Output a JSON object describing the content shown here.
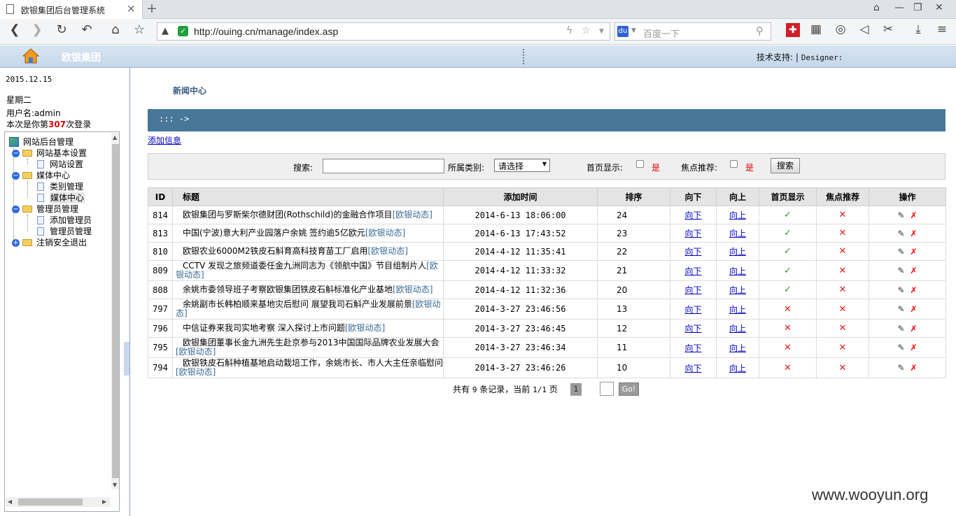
{
  "browser": {
    "tab_title": "欧银集团后台管理系统",
    "tab_close": "×",
    "new_tab": "+",
    "url": "http://ouing.cn/manage/index.asp",
    "search_placeholder": "百度一下"
  },
  "header": {
    "brand": "欧银集团",
    "support": "技术支持: | ",
    "designer": "Designer:"
  },
  "sidebar": {
    "date": "2015.12.15",
    "weekday": "星期二",
    "username": "用户名:admin",
    "login_prefix": "本次是你第",
    "login_count": "307",
    "login_suffix": "次登录",
    "tree": {
      "root": "网站后台管理",
      "basic": "网站基本设置",
      "site_settings": "网站设置",
      "media": "媒体中心",
      "category_mgmt": "类别管理",
      "media_center": "媒体中心",
      "admin": "管理员管理",
      "add_admin": "添加管理员",
      "admin_mgmt": "管理员管理",
      "logout": "注销安全退出"
    }
  },
  "main": {
    "section_title": "新闻中心",
    "breadcrumb": "::: ->",
    "add_link": "添加信息",
    "search": {
      "search_label": "搜索:",
      "category_label": "所属类别:",
      "category_value": "请选择",
      "home_label": "首页显示:",
      "home_yes": "是",
      "focus_label": "焦点推荐:",
      "focus_yes": "是",
      "button": "搜索"
    },
    "columns": [
      "ID",
      "标题",
      "添加时间",
      "排序",
      "向下",
      "向上",
      "首页显示",
      "焦点推荐",
      "操作"
    ],
    "row_labels": {
      "down": "向下",
      "up": "向上",
      "tag": "[欧银动态]",
      "yes": "✓",
      "no": "✕"
    },
    "rows": [
      {
        "id": "814",
        "title": "欧银集团与罗斯柴尔德财团(Rothschild)的金融合作项目",
        "time": "2014-6-13 18:06:00",
        "sort": "24",
        "home": true,
        "focus": false
      },
      {
        "id": "813",
        "title": "中国(宁波)意大利产业园落户余姚 签约逾5亿欧元",
        "time": "2014-6-13 17:43:52",
        "sort": "23",
        "home": true,
        "focus": false
      },
      {
        "id": "810",
        "title": "欧银农业6000M2铁皮石斛育高科技育苗工厂启用",
        "time": "2014-4-12 11:35:41",
        "sort": "22",
        "home": true,
        "focus": false
      },
      {
        "id": "809",
        "title": "CCTV 发现之旅频道委任金九洲同志为《领航中国》节目组制片人",
        "time": "2014-4-12 11:33:32",
        "sort": "21",
        "home": true,
        "focus": false
      },
      {
        "id": "808",
        "title": "余姚市委领导班子考察欧银集团铁皮石斛标准化产业基地",
        "time": "2014-4-12 11:32:36",
        "sort": "20",
        "home": true,
        "focus": false
      },
      {
        "id": "797",
        "title": "余姚副市长韩柏顺来基地灾后慰问 展望我司石斛产业发展前景",
        "time": "2014-3-27 23:46:56",
        "sort": "13",
        "home": false,
        "focus": false
      },
      {
        "id": "796",
        "title": "中信证券来我司实地考察 深入探讨上市问题",
        "time": "2014-3-27 23:46:45",
        "sort": "12",
        "home": false,
        "focus": false
      },
      {
        "id": "795",
        "title": "欧银集团董事长金九洲先生赴京参与2013中国国际品牌农业发展大会",
        "time": "2014-3-27 23:46:34",
        "sort": "11",
        "home": false,
        "focus": false
      },
      {
        "id": "794",
        "title": "欧银铁皮石斛种植基地启动栽培工作，余姚市长、市人大主任亲临慰问",
        "time": "2014-3-27 23:46:26",
        "sort": "10",
        "home": false,
        "focus": false
      }
    ],
    "pager": {
      "text1": "共有 ",
      "total": "9",
      "text2": " 条记录，当前 ",
      "current": "1/1",
      "text3": "  页",
      "page": "1",
      "go": "Go!"
    }
  },
  "watermark": "www.wooyun.org"
}
